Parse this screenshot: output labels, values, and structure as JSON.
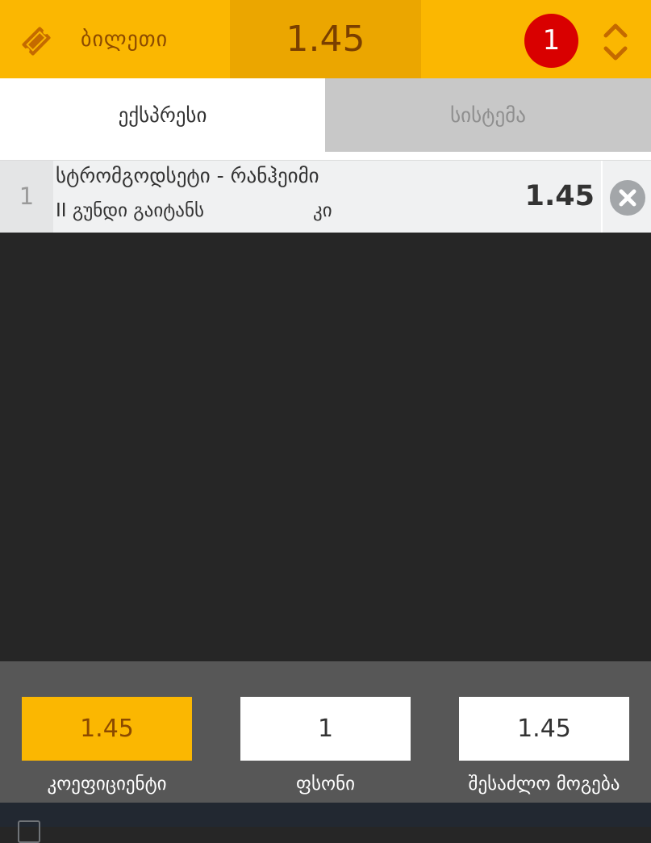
{
  "header": {
    "title": "ბილეთი",
    "total_odds": "1.45",
    "bet_count": "1",
    "brand_color": "#FBB701",
    "ticket_icon": "ticket-icon",
    "expand_icon": "expand-collapse-icon"
  },
  "tabs": [
    {
      "label": "ექსპრესი",
      "active": true
    },
    {
      "label": "სისტემა",
      "active": false
    }
  ],
  "bets": [
    {
      "index": "1",
      "match": "სტრომგოდსეტი - რანჰეიმი",
      "market": "II გუნდი გაიტანს",
      "pick": "კი",
      "odds": "1.45",
      "remove_icon": "close-circle-icon"
    }
  ],
  "footer": {
    "coefficient": {
      "value": "1.45",
      "label": "კოეფიციენტი"
    },
    "stake": {
      "value": "1",
      "label": "ფსონი"
    },
    "possible_win": {
      "value": "1.45",
      "label": "შესაძლო მოგება"
    }
  }
}
